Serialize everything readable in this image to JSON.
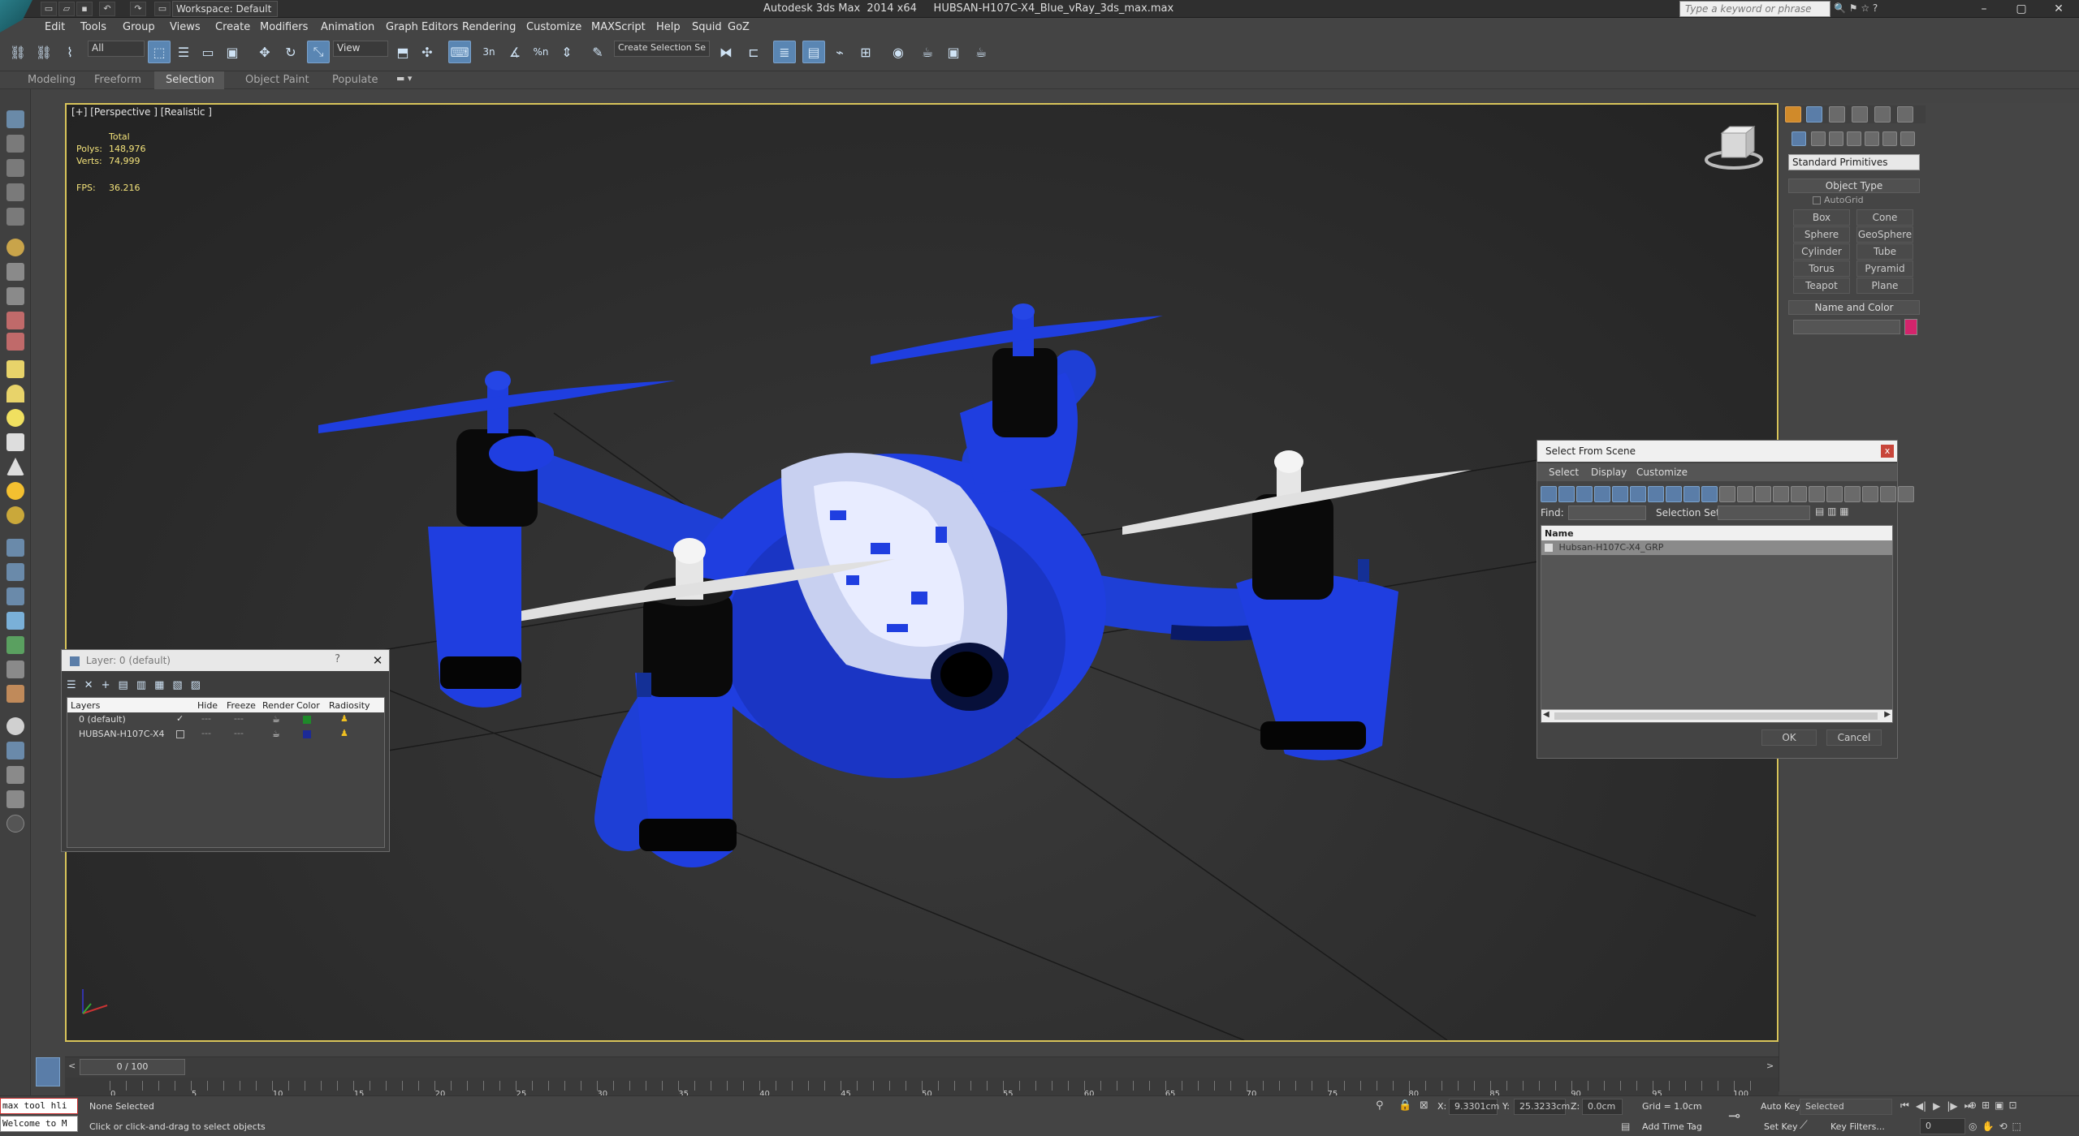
{
  "window": {
    "title": "Autodesk 3ds Max  2014 x64     HUBSAN-H107C-X4_Blue_vRay_3ds_max.max",
    "workspace": "Workspace: Default",
    "search_placeholder": "Type a keyword or phrase",
    "controls": {
      "minimize": "–",
      "maximize": "▢",
      "close": "✕"
    }
  },
  "menubar": [
    "Edit",
    "Tools",
    "Group",
    "Views",
    "Create",
    "Modifiers",
    "Animation",
    "Graph Editors",
    "Rendering",
    "Customize",
    "MAXScript",
    "Help",
    "Squid",
    "GoZ"
  ],
  "toolbar": {
    "filter": "All",
    "ref_coord": "View",
    "named_selection": "Create Selection Se",
    "snap_labels": [
      "3n",
      "%n"
    ]
  },
  "ribbon_tabs": [
    "Modeling",
    "Freeform",
    "Selection",
    "Object Paint",
    "Populate"
  ],
  "viewport": {
    "label": "[+] [Perspective ] [Realistic ]",
    "stats_total": "Total",
    "polys_label": "Polys:",
    "polys_value": "148,976",
    "verts_label": "Verts:",
    "verts_value": "74,999",
    "fps_label": "FPS:",
    "fps_value": "36.216"
  },
  "command_panel": {
    "category": "Standard Primitives",
    "object_type_header": "Object Type",
    "autogrid": "AutoGrid",
    "buttons": [
      "Box",
      "Cone",
      "Sphere",
      "GeoSphere",
      "Cylinder",
      "Tube",
      "Torus",
      "Pyramid",
      "Teapot",
      "Plane"
    ],
    "name_color_header": "Name and Color",
    "color": "#d4246c"
  },
  "layer_dialog": {
    "title": "Layer: 0 (default)",
    "help": "?",
    "close": "✕",
    "columns": [
      "Layers",
      "Hide",
      "Freeze",
      "Render",
      "Color",
      "Radiosity"
    ],
    "rows": [
      {
        "name": "0 (default)",
        "check": "✓",
        "color": "#1f8a2a"
      },
      {
        "name": "HUBSAN-H107C-X4",
        "check": "",
        "color": "#1c2a96"
      }
    ]
  },
  "select_dialog": {
    "title": "Select From Scene",
    "close": "x",
    "menus": [
      "Select",
      "Display",
      "Customize"
    ],
    "find_label": "Find:",
    "selection_set_label": "Selection Set:",
    "column": "Name",
    "items": [
      "Hubsan-H107C-X4_GRP"
    ],
    "ok": "OK",
    "cancel": "Cancel"
  },
  "timeline": {
    "frame": "0 / 100",
    "ticks": [
      "0",
      "5",
      "10",
      "15",
      "20",
      "25",
      "30",
      "35",
      "40",
      "45",
      "50",
      "55",
      "60",
      "65",
      "70",
      "75",
      "80",
      "85",
      "90",
      "95",
      "100"
    ]
  },
  "status": {
    "script_lines": [
      "max tool hli",
      "Welcome to M"
    ],
    "selection": "None Selected",
    "prompt": "Click or click-and-drag to select objects",
    "x_label": "X:",
    "x_value": "9.3301cm",
    "y_label": "Y:",
    "y_value": "25.3233cm",
    "z_label": "Z:",
    "z_value": "0.0cm",
    "grid": "Grid = 1.0cm",
    "add_time_tag": "Add Time Tag",
    "auto_key": "Auto Key",
    "set_key": "Set Key",
    "key_mode": "Selected",
    "key_filters": "Key Filters...",
    "frame_field": "0"
  }
}
